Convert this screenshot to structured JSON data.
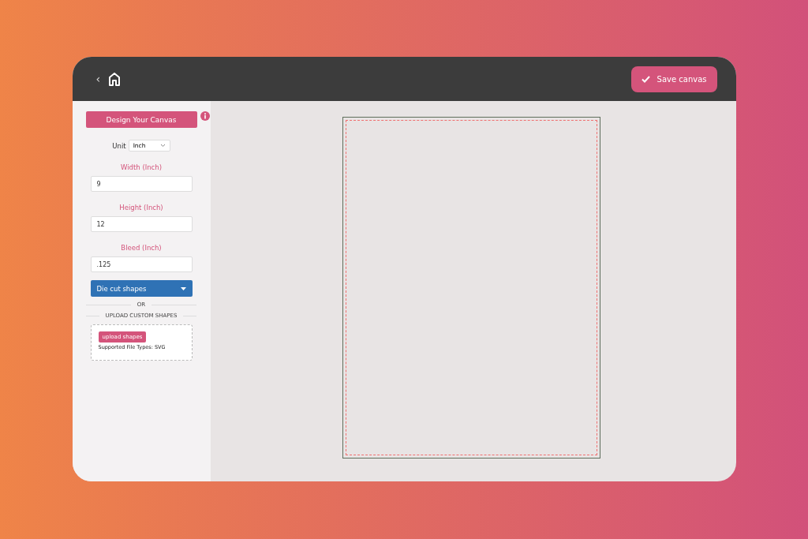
{
  "header": {
    "back": "‹",
    "save_button": "Save canvas"
  },
  "sidebar": {
    "title_button": "Design Your Canvas",
    "unit": {
      "label": "Unit",
      "value": "Inch"
    },
    "fields": [
      {
        "label": "Width (Inch)",
        "value": "9"
      },
      {
        "label": "Height (Inch)",
        "value": "12"
      },
      {
        "label": "Bleed (Inch)",
        "value": ".125"
      }
    ],
    "shapes_dropdown": "Die cut shapes",
    "or_divider": "OR",
    "upload_divider": "UPLOAD CUSTOM SHAPES",
    "upload": {
      "button": "upload shapes",
      "hint": "Supported File Types: SVG"
    }
  }
}
